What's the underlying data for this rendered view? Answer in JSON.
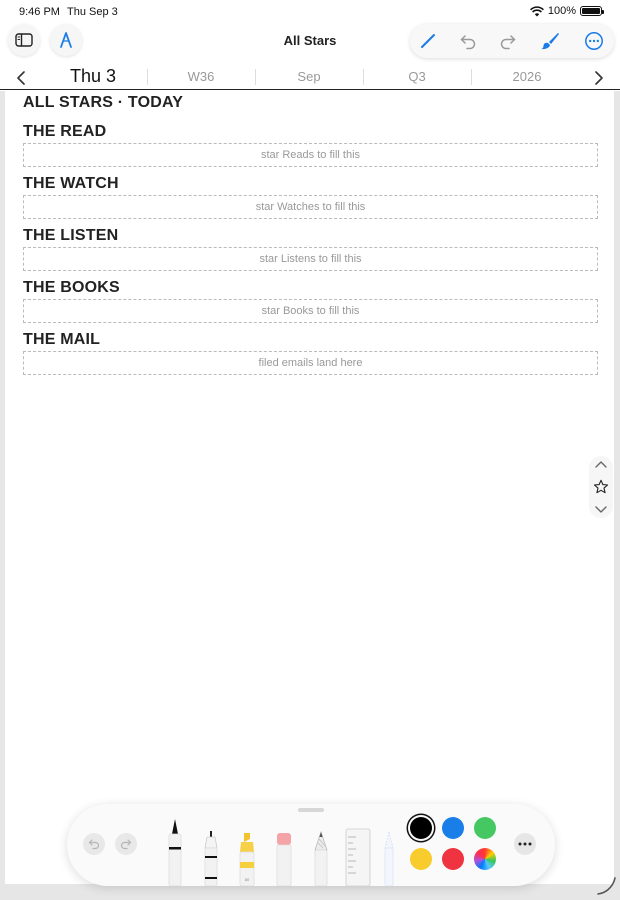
{
  "status_bar": {
    "time": "9:46 PM",
    "date": "Thu Sep 3",
    "battery": "100%"
  },
  "toolbar": {
    "title": "All Stars"
  },
  "date_nav": {
    "day": "Thu 3",
    "week": "W36",
    "month": "Sep",
    "quarter": "Q3",
    "year": "2026"
  },
  "page": {
    "heading": "ALL STARS · TODAY",
    "sections": [
      {
        "title": "THE READ",
        "placeholder": "star Reads to fill this"
      },
      {
        "title": "THE WATCH",
        "placeholder": "star Watches to fill this"
      },
      {
        "title": "THE LISTEN",
        "placeholder": "star Listens to fill this"
      },
      {
        "title": "THE BOOKS",
        "placeholder": "star Books to fill this"
      },
      {
        "title": "THE MAIL",
        "placeholder": "filed emails land here"
      }
    ]
  },
  "colors": {
    "accent": "#1a7ce6",
    "swatches": [
      "#000000",
      "#1a7ee8",
      "#45c861",
      "#f7cc2c",
      "#ef3340",
      "rainbow"
    ]
  },
  "icons": {
    "sidebar": "sidebar-icon",
    "markup": "markup-icon",
    "pen": "pen-icon",
    "undo": "undo-icon",
    "redo": "redo-icon",
    "brush": "brush-icon",
    "more": "more-icon",
    "star": "star-icon"
  }
}
